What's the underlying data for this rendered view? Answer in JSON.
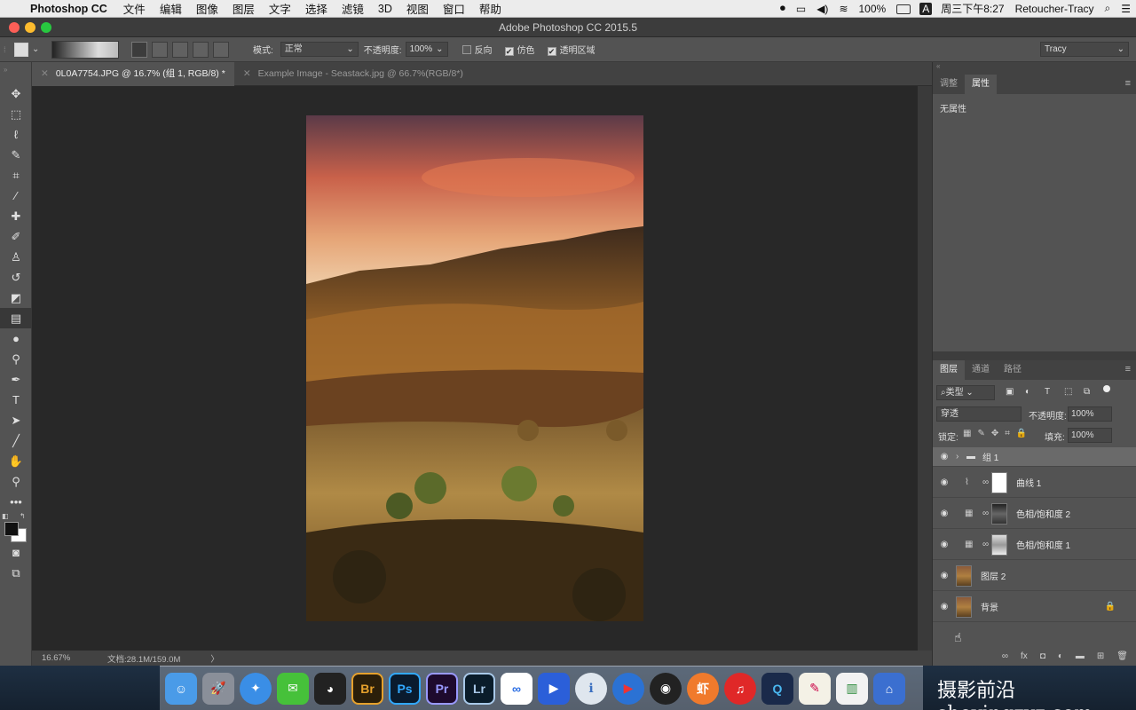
{
  "menubar": {
    "app_name": "Photoshop CC",
    "items": [
      "文件",
      "编辑",
      "图像",
      "图层",
      "文字",
      "选择",
      "滤镜",
      "3D",
      "视图",
      "窗口",
      "帮助"
    ],
    "battery": "100%",
    "clock": "周三下午8:27",
    "input_method": "A",
    "user": "Retoucher-Tracy"
  },
  "window": {
    "title": "Adobe Photoshop CC 2015.5"
  },
  "options": {
    "mode_label": "模式:",
    "mode_value": "正常",
    "opacity_label": "不透明度:",
    "opacity_value": "100%",
    "reverse_label": "反向",
    "dither_label": "仿色",
    "transparency_label": "透明区域",
    "workspace": "Tracy"
  },
  "tabs": [
    {
      "label": "0L0A7754.JPG @ 16.7% (组 1, RGB/8) *"
    },
    {
      "label": "Example Image - Seastack.jpg @ 66.7%(RGB/8*)"
    }
  ],
  "status": {
    "zoom": "16.67%",
    "doc": "文档:28.1M/159.0M",
    "arrow": "〉"
  },
  "props_panel": {
    "tabs": [
      "调整",
      "属性"
    ],
    "content": "无属性"
  },
  "layers_panel": {
    "tabs": [
      "图层",
      "通道",
      "路径"
    ],
    "filter_kind": "类型",
    "blend_mode": "穿透",
    "opacity_label": "不透明度:",
    "opacity_value": "100%",
    "lock_label": "锁定:",
    "fill_label": "填充:",
    "fill_value": "100%",
    "layers": [
      {
        "name": "组 1"
      },
      {
        "name": "曲线 1"
      },
      {
        "name": "色相/饱和度 2"
      },
      {
        "name": "色相/饱和度 1"
      },
      {
        "name": "图层 2"
      },
      {
        "name": "背景"
      }
    ]
  },
  "dock": {
    "icons": [
      "Finder",
      "Launchpad",
      "Safari",
      "WeChat",
      "QQ",
      "Br",
      "Ps",
      "Pr",
      "Lr",
      "Baidu",
      "Video",
      "Info",
      "Player",
      "OBS",
      "Xia",
      "NetEase",
      "Q",
      "Docs",
      "Charts",
      "Keynote"
    ]
  },
  "watermark": "摄影前沿 sheyingzyz.com"
}
